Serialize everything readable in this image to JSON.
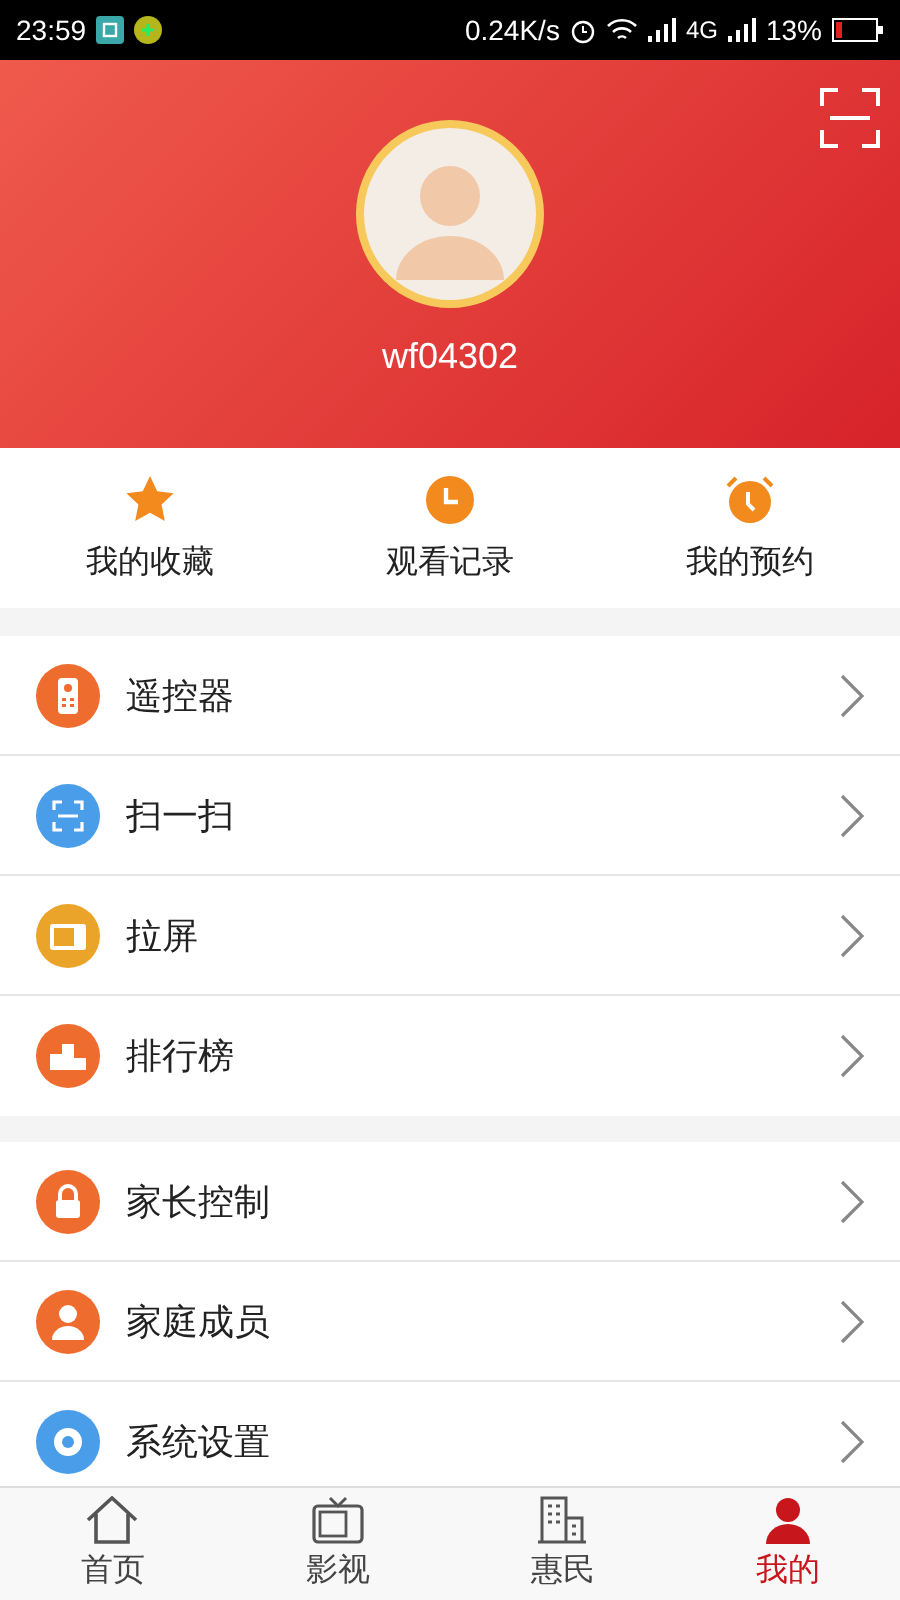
{
  "status_bar": {
    "time": "23:59",
    "speed": "0.24K/s",
    "network": "4G",
    "battery": "13%"
  },
  "profile": {
    "username": "wf04302"
  },
  "quick_actions": [
    {
      "label": "我的收藏",
      "kind": "star"
    },
    {
      "label": "观看记录",
      "kind": "clock"
    },
    {
      "label": "我的预约",
      "kind": "alarm"
    }
  ],
  "menu_groups": [
    [
      {
        "label": "遥控器",
        "kind": "remote",
        "color": "#ef6c2f"
      },
      {
        "label": "扫一扫",
        "kind": "scan",
        "color": "#4a9de8"
      },
      {
        "label": "拉屏",
        "kind": "cast",
        "color": "#eba42a"
      },
      {
        "label": "排行榜",
        "kind": "ranking",
        "color": "#ef6c2f"
      }
    ],
    [
      {
        "label": "家长控制",
        "kind": "lock",
        "color": "#ef6c2f"
      },
      {
        "label": "家庭成员",
        "kind": "family",
        "color": "#ef6c2f"
      },
      {
        "label": "系统设置",
        "kind": "settings",
        "color": "#4a9de8"
      }
    ]
  ],
  "bottom_nav": [
    {
      "label": "首页",
      "kind": "home",
      "selected": false
    },
    {
      "label": "影视",
      "kind": "tv",
      "selected": false
    },
    {
      "label": "惠民",
      "kind": "building",
      "selected": false
    },
    {
      "label": "我的",
      "kind": "user",
      "selected": true
    }
  ]
}
